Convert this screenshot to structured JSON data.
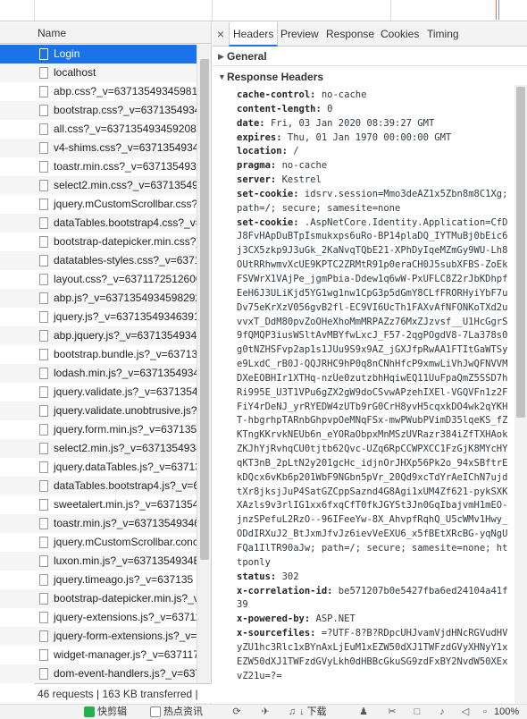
{
  "list": {
    "header": "Name",
    "rows": [
      "Login",
      "localhost",
      "abp.css?_v=637135493459819",
      "bootstrap.css?_v=637135493459",
      "all.css?_v=6371354934592087",
      "v4-shims.css?_v=63713549345",
      "toastr.min.css?_v=637135493",
      "select2.min.css?_v=63713549",
      "jquery.mCustomScrollbar.css?_",
      "dataTables.bootstrap4.css?_v=",
      "bootstrap-datepicker.min.css?_",
      "datatables-styles.css?_v=6371",
      "layout.css?_v=6371172512600",
      "abp.js?_v=6371354934598292",
      "jquery.js?_v=637135493463911",
      "abp.jquery.js?_v=637135493459",
      "bootstrap.bundle.js?_v=637135",
      "lodash.min.js?_v=6371354934",
      "jquery.validate.js?_v=6371354",
      "jquery.validate.unobtrusive.js?_",
      "jquery.form.min.js?_v=637135",
      "select2.min.js?_v=6371354934",
      "jquery.dataTables.js?_v=6371354",
      "dataTables.bootstrap4.js?_v=6",
      "sweetalert.min.js?_v=63713549",
      "toastr.min.js?_v=63713549346",
      "jquery.mCustomScrollbar.conc",
      "luxon.min.js?_v=6371354934E",
      "jquery.timeago.js?_v=637135",
      "bootstrap-datepicker.min.js?_v",
      "jquery-extensions.js?_v=63711",
      "jquery-form-extensions.js?_v=",
      "widget-manager.js?_v=637117",
      "dom-event-handlers.js?_v=637"
    ],
    "status": "46 requests | 163 KB transferred |"
  },
  "tabs": [
    "Headers",
    "Preview",
    "Response",
    "Cookies",
    "Timing"
  ],
  "close_symbol": "×",
  "sections": {
    "general": "General",
    "response_headers": "Response Headers"
  },
  "headers": [
    {
      "k": "cache-control:",
      "v": "no-cache"
    },
    {
      "k": "content-length:",
      "v": "0"
    },
    {
      "k": "date:",
      "v": "Fri, 03 Jan 2020 08:39:27 GMT"
    },
    {
      "k": "expires:",
      "v": "Thu, 01 Jan 1970 00:00:00 GMT"
    },
    {
      "k": "location:",
      "v": "/"
    },
    {
      "k": "pragma:",
      "v": "no-cache"
    },
    {
      "k": "server:",
      "v": "Kestrel"
    },
    {
      "k": "set-cookie:",
      "v": "idsrv.session=Mmo3deAZ1x5Zbn8m8C1Xg; path=/; secure; samesite=none"
    },
    {
      "k": "set-cookie:",
      "v": ".AspNetCore.Identity.Application=CfDJ8FvHApDuBTpIsmukxps6uRo-BP14plaDQ_IYTMuBj0bEic6j3CX5zkp9J3uGk_2KaNvqTQbE21-XPhDyIqeMZmGy9WU-Lh8OUtRRhwmvXcUE9KPTC2ZRMtR91p0eraCH0J5subXFBS-ZoEkFSVWrX1VAjPe_jgmPbia-Ddew1q6wW-PxUFLC8Z2rJbKDhpfEeH6J3ULiKjd5YG1wg1nw1CpG3p5dGmY8CLfFRORHyiYbF7uDv75eKrXzV056gvB2fl-EC9VI6UcTh1FAXvAfNFONKoTXd2uvvxT_DdM80pvZoOHeXhoMmMRPAZz76MxZJzvsf__U1HcGgrS9fQMQP3iusWSltAvMBYfwLxcJ_F57-2qgPOgdV8-7La378s0g0tNZHSFvp2ap1s1JUu9S9x9AZ_jGXJfpRwAA1FTItGaWTSye9LxdC_rB0J-QQJRHC9hP0q8nCNhHfcP9xmwLiVhJwQFNVVMDXeEOBHIr1XTHq-nzUe0zutzbhHqiwEQ11UuFpaQmZ5SSD7hRi995E_U3T1VPu6gZX2gW9doCSvwAPzehIXEl-VGQVFn1z2FFiY4rDeNJ_yrRYEDW4zUTb9rG0CrH8yvH5cqxkDO4wk2qYKHT-hbgrhpTARnbGhpvpOeMNqFSx-mwPWubPVimD35lqeKS_fZKTngKKrvkNEUb6n_eYORaObpxMnMSzUVRazr384iZfTXHAokZKJhYjRvhqCU0tjtb62Qvc-UZq6RpCCWPXCC1FzGjK8MYcHYqKT3nB_2pLtN2y201gcHc_idjnOrJHXp56Pk2o_94xSBftrEkDQcx6vKb6p201WbF9NGbn5pVr_20Qd9xcTdYrAeIChN7ujdtXr8jksjJuP4SatGZCppSaznd4G8Agi1xUM4Zf621-pykSXKXAzls9v3rlIG1xx6fxqCfT0fkJGYSt3Jn0GqIbajvmH1mEO-jnzSPefuL2RzO--96IFeeYw-8X_AhvpfRqhQ_U5cWMv1Hwy_ODdIRXuJ2_BtJxmJfvJz6ievVeEXU6_x5fBEtXRcBG-yqNgUFQa1IlTR90aJw; path=/; secure; samesite=none; httponly"
    },
    {
      "k": "status:",
      "v": "302"
    },
    {
      "k": "x-correlation-id:",
      "v": "be571207b0e5427fba6ed24104a41f39"
    },
    {
      "k": "x-powered-by:",
      "v": "ASP.NET"
    },
    {
      "k": "x-sourcefiles:",
      "v": "=?UTF-8?B?RDpcUHJvamVjdHNcRGVudHVyZU1hc3Rlc1xBYnAxLjEuM1xEZW50dXJ1TWFzdGVyXHNyY1xEZW50dXJ1TWFzdGVyLkh0dHBBcGkuSG9zdFxBY2NvdW50XExvZ21u=?="
    }
  ],
  "taskbar": {
    "item1": "快剪辑",
    "item2": "热点资讯",
    "item3": "下载",
    "zoom": "100%"
  },
  "colors": {
    "selected_row": "#1a73e8",
    "active_tab_underline": "#1a73e8"
  }
}
